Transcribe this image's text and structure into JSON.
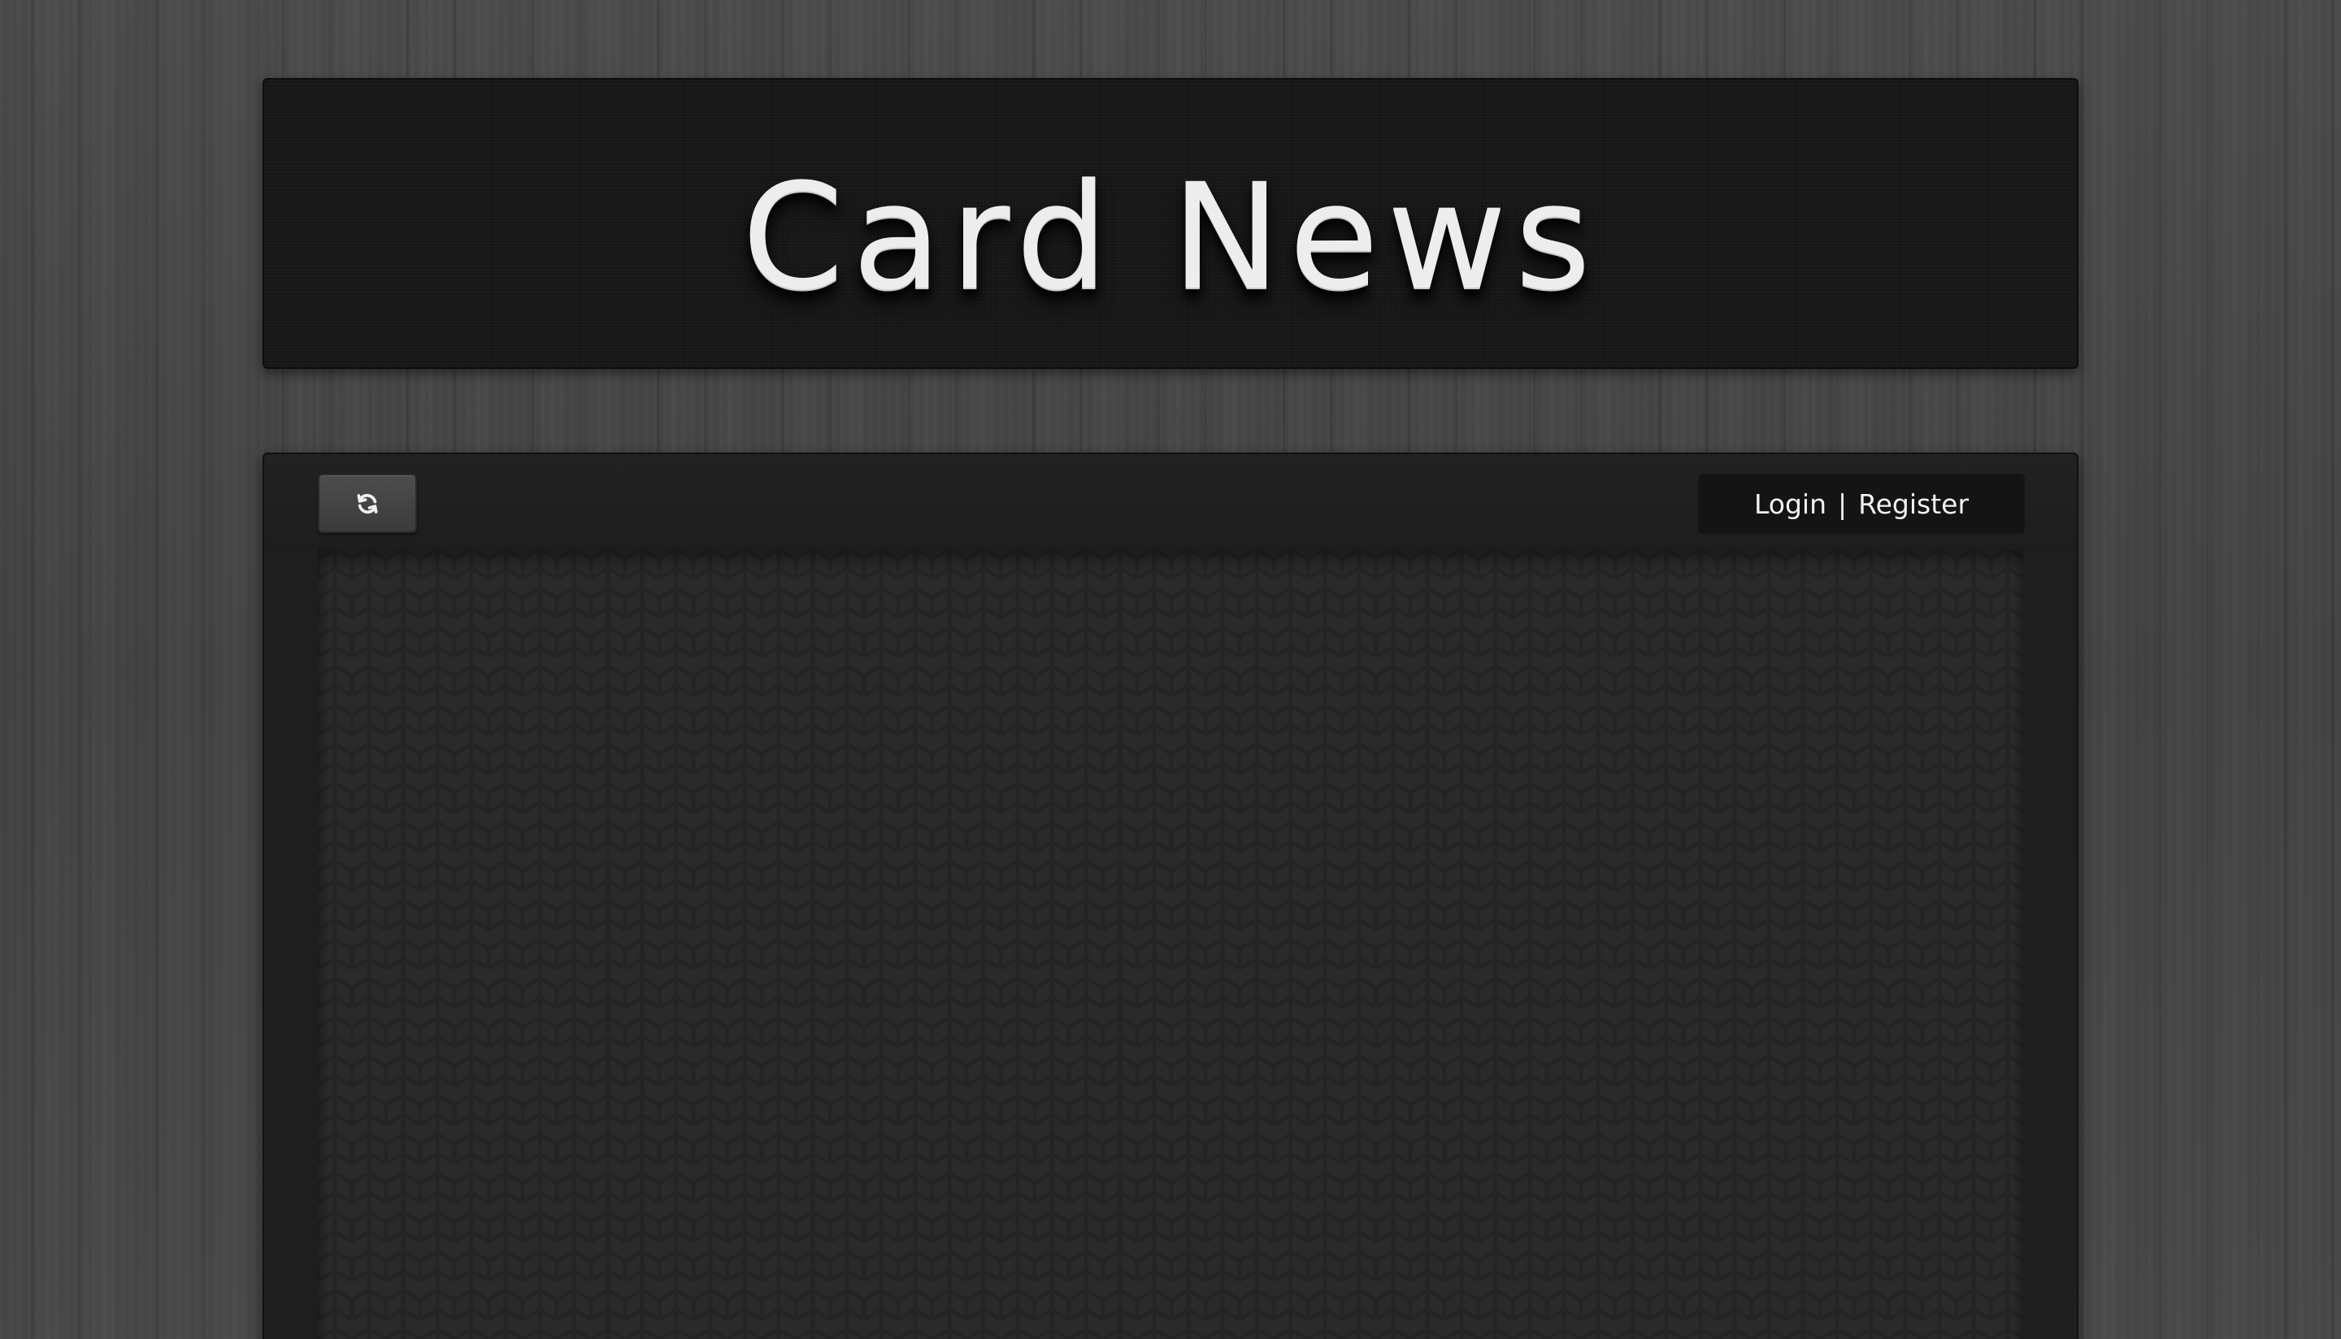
{
  "header": {
    "title": "Card News"
  },
  "toolbar": {
    "refresh_icon": "refresh-icon"
  },
  "auth": {
    "login_label": "Login",
    "separator": "|",
    "register_label": "Register"
  }
}
